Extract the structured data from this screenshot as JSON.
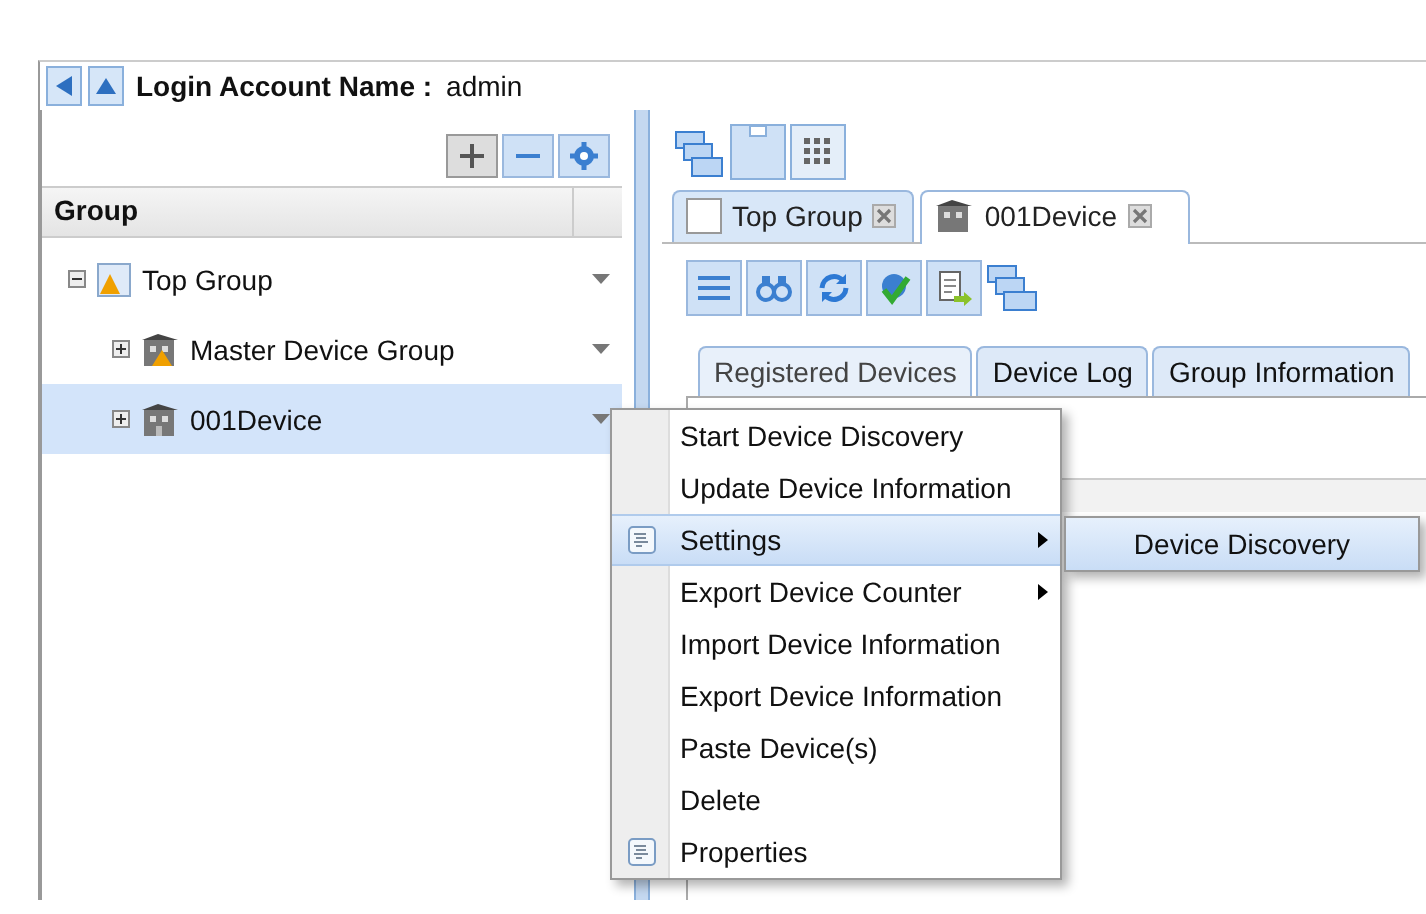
{
  "header": {
    "label": "Login Account Name :",
    "user": "admin"
  },
  "group_panel": {
    "title": "Group",
    "tree": [
      {
        "label": "Top Group",
        "kind": "group",
        "expanded": true,
        "selected": false,
        "children": [
          {
            "label": "Master Device Group",
            "kind": "device-group",
            "expanded": false,
            "selected": false
          },
          {
            "label": "001Device",
            "kind": "device",
            "expanded": false,
            "selected": true
          }
        ]
      }
    ]
  },
  "tabs": [
    {
      "label": "Top Group",
      "kind": "group",
      "selected": false
    },
    {
      "label": "001Device",
      "kind": "device",
      "selected": true
    }
  ],
  "sub_tabs": [
    {
      "label": "Registered Devices",
      "selected": true
    },
    {
      "label": "Device Log",
      "selected": false
    },
    {
      "label": "Group Information",
      "selected": false
    }
  ],
  "context_menu": [
    {
      "label": "Start Device Discovery",
      "icon": false,
      "submenu": false,
      "selected": false
    },
    {
      "label": "Update Device Information",
      "icon": false,
      "submenu": false,
      "selected": false
    },
    {
      "label": "Settings",
      "icon": true,
      "submenu": true,
      "selected": true
    },
    {
      "label": "Export Device Counter",
      "icon": false,
      "submenu": true,
      "selected": false
    },
    {
      "label": "Import Device Information",
      "icon": false,
      "submenu": false,
      "selected": false
    },
    {
      "label": "Export Device Information",
      "icon": false,
      "submenu": false,
      "selected": false
    },
    {
      "label": "Paste Device(s)",
      "icon": false,
      "submenu": false,
      "selected": false
    },
    {
      "label": "Delete",
      "icon": false,
      "submenu": false,
      "selected": false
    },
    {
      "label": "Properties",
      "icon": true,
      "submenu": false,
      "selected": false
    }
  ],
  "submenu": [
    {
      "label": "Device Discovery",
      "selected": true
    }
  ]
}
